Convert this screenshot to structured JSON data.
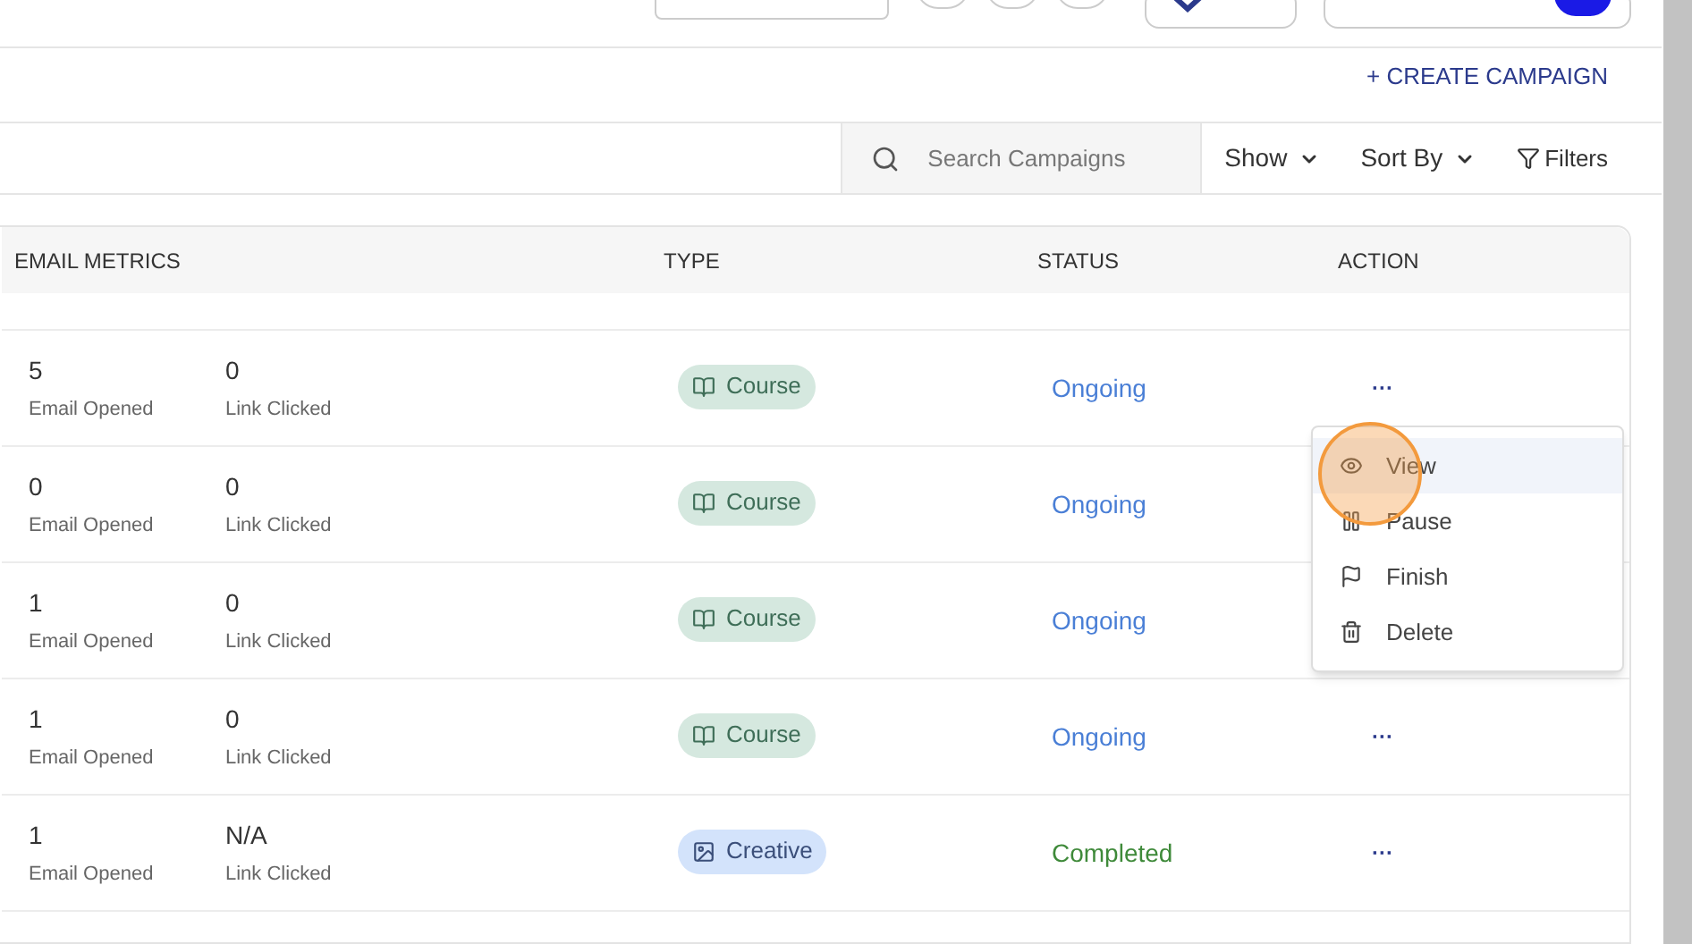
{
  "header": {
    "create_button": "+ CREATE CAMPAIGN"
  },
  "toolbar": {
    "search": {
      "placeholder": "Search Campaigns"
    },
    "show": "Show",
    "sort": "Sort By",
    "filters": "Filters"
  },
  "table": {
    "columns": [
      "EMAIL METRICS",
      "TYPE",
      "STATUS",
      "ACTION"
    ],
    "rows": [
      {
        "opened": "5",
        "opened_label": "Email Opened",
        "clicked": "0",
        "clicked_label": "Link Clicked",
        "type": {
          "kind": "course",
          "label": "Course"
        },
        "status": {
          "kind": "ongoing",
          "label": "Ongoing"
        },
        "action": "···",
        "menu_open": true
      },
      {
        "opened": "0",
        "opened_label": "Email Opened",
        "clicked": "0",
        "clicked_label": "Link Clicked",
        "type": {
          "kind": "course",
          "label": "Course"
        },
        "status": {
          "kind": "ongoing",
          "label": "Ongoing"
        },
        "menu_open": false
      },
      {
        "opened": "1",
        "opened_label": "Email Opened",
        "clicked": "0",
        "clicked_label": "Link Clicked",
        "type": {
          "kind": "course",
          "label": "Course"
        },
        "status": {
          "kind": "ongoing",
          "label": "Ongoing"
        },
        "menu_open": false
      },
      {
        "opened": "1",
        "opened_label": "Email Opened",
        "clicked": "0",
        "clicked_label": "Link Clicked",
        "type": {
          "kind": "course",
          "label": "Course"
        },
        "status": {
          "kind": "ongoing",
          "label": "Ongoing"
        },
        "action": "···",
        "menu_open": false
      },
      {
        "opened": "1",
        "opened_label": "Email Opened",
        "clicked": "N/A",
        "clicked_label": "Link Clicked",
        "type": {
          "kind": "creative",
          "label": "Creative"
        },
        "status": {
          "kind": "completed",
          "label": "Completed"
        },
        "action": "···",
        "menu_open": false
      }
    ]
  },
  "action_menu": {
    "items": [
      {
        "kind": "view",
        "label": "View",
        "selected": true
      },
      {
        "kind": "pause",
        "label": "Pause",
        "selected": false
      },
      {
        "kind": "finish",
        "label": "Finish",
        "selected": false
      },
      {
        "kind": "delete",
        "label": "Delete",
        "selected": false
      }
    ]
  }
}
